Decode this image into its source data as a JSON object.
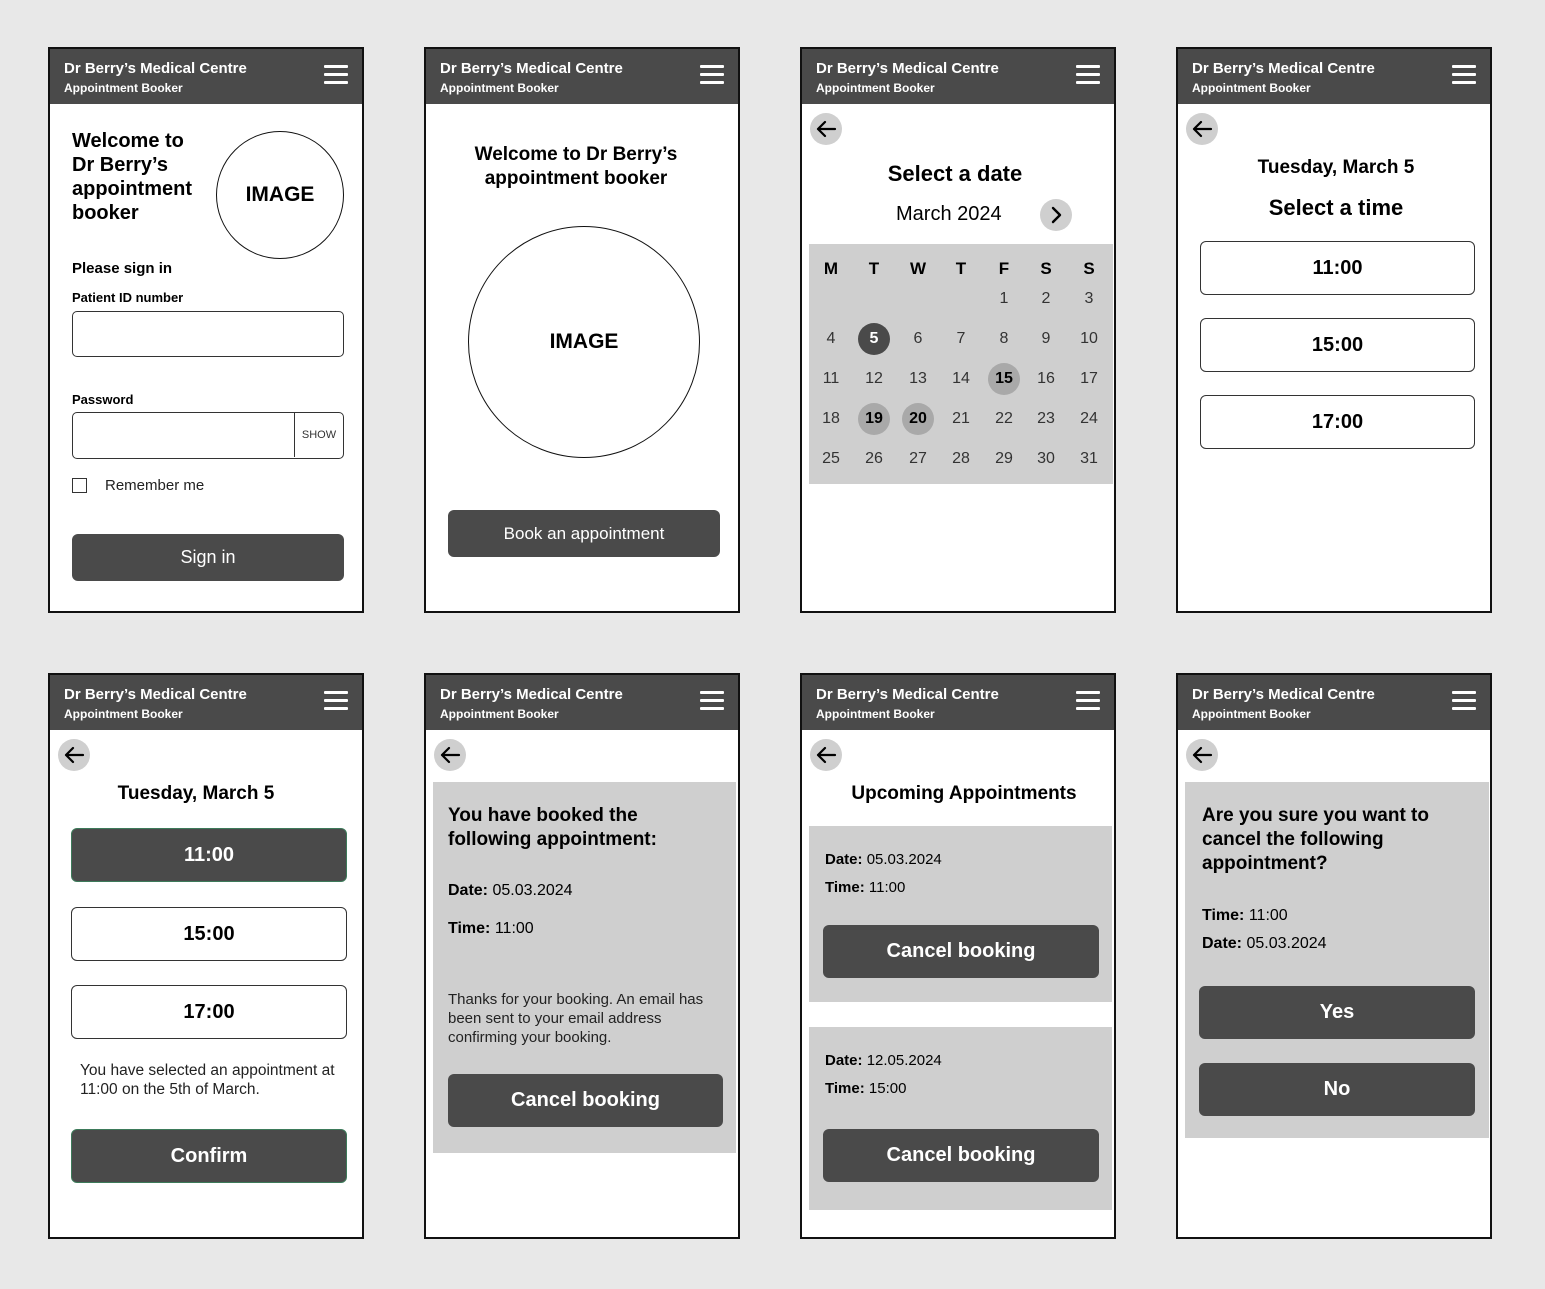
{
  "app": {
    "title": "Dr Berry’s Medical Centre",
    "subtitle": "Appointment Booker"
  },
  "screen1": {
    "welcome": "Welcome to Dr Berry’s appointment booker",
    "image": "IMAGE",
    "sign_in_prompt": "Please sign in",
    "patient_id_label": "Patient ID number",
    "patient_id_value": "",
    "password_label": "Password",
    "password_value": "",
    "show_label": "SHOW",
    "remember_label": "Remember me",
    "sign_in_button": "Sign in"
  },
  "screen2": {
    "welcome": "Welcome to Dr Berry’s appointment booker",
    "image": "IMAGE",
    "book_button": "Book an appointment"
  },
  "screen3": {
    "title": "Select a date",
    "month": "March 2024",
    "weekdays": [
      "M",
      "T",
      "W",
      "T",
      "F",
      "S",
      "S"
    ],
    "weeks": [
      [
        "",
        "",
        "",
        "",
        "1",
        "2",
        "3"
      ],
      [
        "4",
        "5",
        "6",
        "7",
        "8",
        "9",
        "10"
      ],
      [
        "11",
        "12",
        "13",
        "14",
        "15",
        "16",
        "17"
      ],
      [
        "18",
        "19",
        "20",
        "21",
        "22",
        "23",
        "24"
      ],
      [
        "25",
        "26",
        "27",
        "28",
        "29",
        "30",
        "31"
      ]
    ],
    "selected_day": "5",
    "available_days": [
      "15",
      "19",
      "20"
    ]
  },
  "screen4": {
    "date": "Tuesday, March 5",
    "title": "Select a time",
    "times": [
      "11:00",
      "15:00",
      "17:00"
    ]
  },
  "screen5": {
    "date": "Tuesday, March 5",
    "times": [
      "11:00",
      "15:00",
      "17:00"
    ],
    "selected_time": "11:00",
    "summary": "You have selected an appointment at 11:00 on the 5th of March.",
    "confirm_button": "Confirm"
  },
  "screen6": {
    "heading": "You have booked the following appointment:",
    "date_label": "Date:",
    "date_value": "05.03.2024",
    "time_label": "Time:",
    "time_value": "11:00",
    "thanks": "Thanks for your booking. An email has been sent to your email address confirming your booking.",
    "cancel_button": "Cancel booking"
  },
  "screen7": {
    "title": "Upcoming Appointments",
    "appointments": [
      {
        "date_label": "Date:",
        "date": "05.03.2024",
        "time_label": "Time:",
        "time": "11:00",
        "cancel": "Cancel booking"
      },
      {
        "date_label": "Date:",
        "date": "12.05.2024",
        "time_label": "Time:",
        "time": "15:00",
        "cancel": "Cancel booking"
      }
    ]
  },
  "screen8": {
    "question": "Are you sure you want to cancel the following appointment?",
    "time_label": "Time:",
    "time_value": "11:00",
    "date_label": "Date:",
    "date_value": "05.03.2024",
    "yes_button": "Yes",
    "no_button": "No"
  },
  "colors": {
    "header": "#4a4a4a",
    "panel": "#cfcfcf",
    "background": "#e8e8e8",
    "available_day": "#a9a9a9"
  },
  "icons": {
    "menu": "hamburger-menu-icon",
    "back": "arrow-left-icon",
    "next": "chevron-right-icon",
    "checkbox": "checkbox-icon"
  }
}
